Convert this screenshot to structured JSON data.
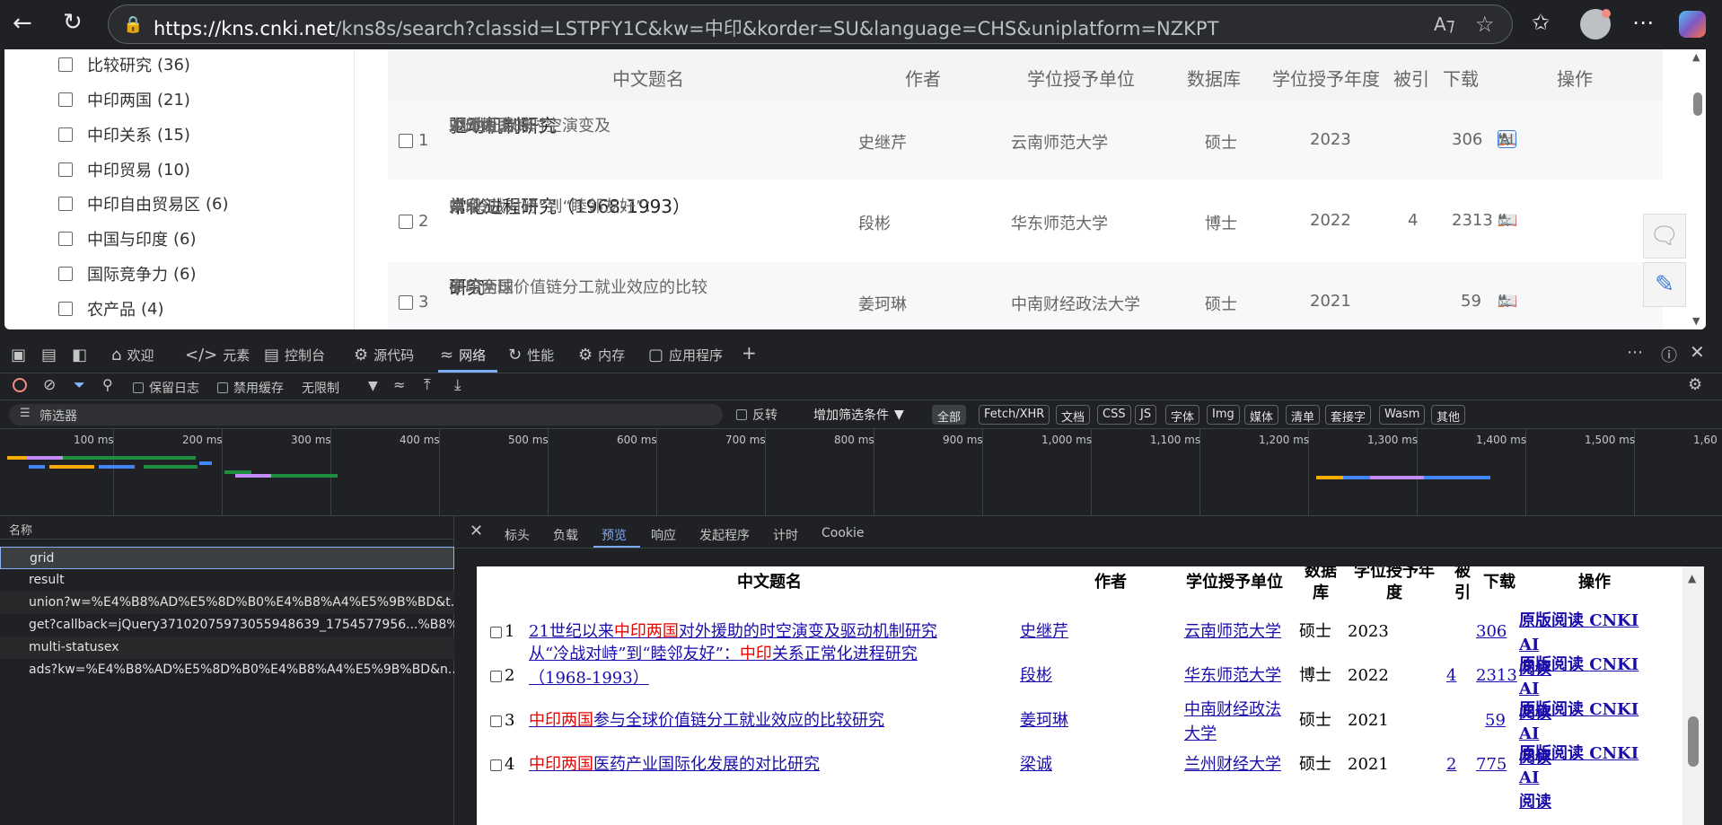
{
  "browser": {
    "url_host": "https://kns.cnki.net",
    "url_rest": "/kns8s/search?classid=LSTPFY1C&kw=中印&korder=SU&language=CHS&uniplatform=NZKPT"
  },
  "facets": [
    {
      "label": "比较研究",
      "count": "(36)"
    },
    {
      "label": "中印两国",
      "count": "(21)"
    },
    {
      "label": "中印关系",
      "count": "(15)"
    },
    {
      "label": "中印贸易",
      "count": "(10)"
    },
    {
      "label": "中印自由贸易区",
      "count": "(6)"
    },
    {
      "label": "中国与印度",
      "count": "(6)"
    },
    {
      "label": "国际竞争力",
      "count": "(6)"
    },
    {
      "label": "农产品",
      "count": "(4)"
    }
  ],
  "results_table": {
    "headers": {
      "title": "中文题名",
      "author": "作者",
      "unit": "学位授予单位",
      "db": "数据库",
      "year": "学位授予年度",
      "cited": "被引",
      "downloads": "下载",
      "ops": "操作"
    },
    "rows": [
      {
        "no": "1",
        "t1a": "21世纪以来",
        "t1hl": "中印两国",
        "t1b": "对外援助的时空演变及",
        "t2": "驱动机制研究",
        "author": "史继芹",
        "unit": "云南师范大学",
        "db": "硕士",
        "year": "2023",
        "cited": "",
        "downloads": "306"
      },
      {
        "no": "2",
        "t1a": "从“冷战对峙”到“睦邻友好”：",
        "t1hl": "中印",
        "t1b": "关系正",
        "t2": "常化进程研究（1968-1993）",
        "author": "段彬",
        "unit": "华东师范大学",
        "db": "博士",
        "year": "2022",
        "cited": "4",
        "downloads": "2313"
      },
      {
        "no": "3",
        "t1a": "",
        "t1hl": "中印两国",
        "t1b": "参与全球价值链分工就业效应的比较",
        "t2": "研究",
        "author": "姜珂琳",
        "unit": "中南财经政法大学",
        "db": "硕士",
        "year": "2021",
        "cited": "",
        "downloads": "59"
      }
    ]
  },
  "devtools": {
    "tabs": [
      "欢迎",
      "元素",
      "控制台",
      "源代码",
      "网络",
      "性能",
      "内存",
      "应用程序"
    ],
    "active_tab": "网络",
    "toolbar": {
      "preserve_log": "保留日志",
      "disable_cache": "禁用缓存",
      "throttle": "无限制"
    },
    "filter": {
      "placeholder": "筛选器",
      "invert": "反转",
      "more_filters": "增加筛选条件"
    },
    "chips": [
      "全部",
      "Fetch/XHR",
      "文档",
      "CSS",
      "JS",
      "字体",
      "Img",
      "媒体",
      "清单",
      "套接字",
      "Wasm",
      "其他"
    ],
    "timeline_ticks": [
      "100 ms",
      "200 ms",
      "300 ms",
      "400 ms",
      "500 ms",
      "600 ms",
      "700 ms",
      "800 ms",
      "900 ms",
      "1,000 ms",
      "1,100 ms",
      "1,200 ms",
      "1,300 ms",
      "1,400 ms",
      "1,500 ms",
      "1,60"
    ],
    "name_header": "名称",
    "requests": [
      "grid",
      "result",
      "union?w=%E4%B8%AD%E5%8D%B0%E4%B8%A4%E5%9B%BD&t...",
      "get?callback=jQuery37102075973055948639_1754577956...%B8%...",
      "multi-statusex",
      "ads?kw=%E4%B8%AD%E5%8D%B0%E4%B8%A4%E5%9B%BD&n..."
    ],
    "panel_tabs": [
      "标头",
      "负载",
      "预览",
      "响应",
      "发起程序",
      "计时",
      "Cookie"
    ],
    "active_panel_tab": "预览"
  },
  "preview": {
    "headers": {
      "title": "中文题名",
      "author": "作者",
      "unit": "学位授予单位",
      "db1": "数据",
      "db2": "库",
      "year1": "学位授予年",
      "year2": "度",
      "cited1": "被",
      "cited2": "引",
      "downloads": "下载",
      "ops": "操作"
    },
    "op1": "原版阅读",
    "op2": "CNKI AI",
    "op3": "阅读",
    "rows": [
      {
        "no": "1",
        "t1a": "21世纪以来",
        "t1hl": "中印两国",
        "t1b": "对外援助的时空演变及驱动机制研究",
        "t2a": "",
        "t2b": "",
        "author": "史继芹",
        "unit1": "云南师范大学",
        "unit2": "",
        "db": "硕士",
        "year": "2023",
        "cited": "",
        "downloads": "306"
      },
      {
        "no": "2",
        "t1a": "从“冷战对峙”到“睦邻友好”：",
        "t1hl": "中印",
        "t1b": "关系正常化进程研究",
        "t2a": "（1968-1993）",
        "t2b": "",
        "author": "段彬",
        "unit1": "华东师范大学",
        "unit2": "",
        "db": "博士",
        "year": "2022",
        "cited": "4",
        "downloads": "2313"
      },
      {
        "no": "3",
        "t1a": "",
        "t1hl": "中印两国",
        "t1b": "参与全球价值链分工就业效应的比较研究",
        "t2a": "",
        "t2b": "",
        "author": "姜珂琳",
        "unit1": "中南财经政法",
        "unit2": "大学",
        "db": "硕士",
        "year": "2021",
        "cited": "",
        "downloads": "59"
      },
      {
        "no": "4",
        "t1a": "",
        "t1hl": "中印两国",
        "t1b": "医药产业国际化发展的对比研究",
        "t2a": "",
        "t2b": "",
        "author": "梁诚",
        "unit1": "兰州财经大学",
        "unit2": "",
        "db": "硕士",
        "year": "2021",
        "cited": "2",
        "downloads": "775"
      }
    ]
  }
}
